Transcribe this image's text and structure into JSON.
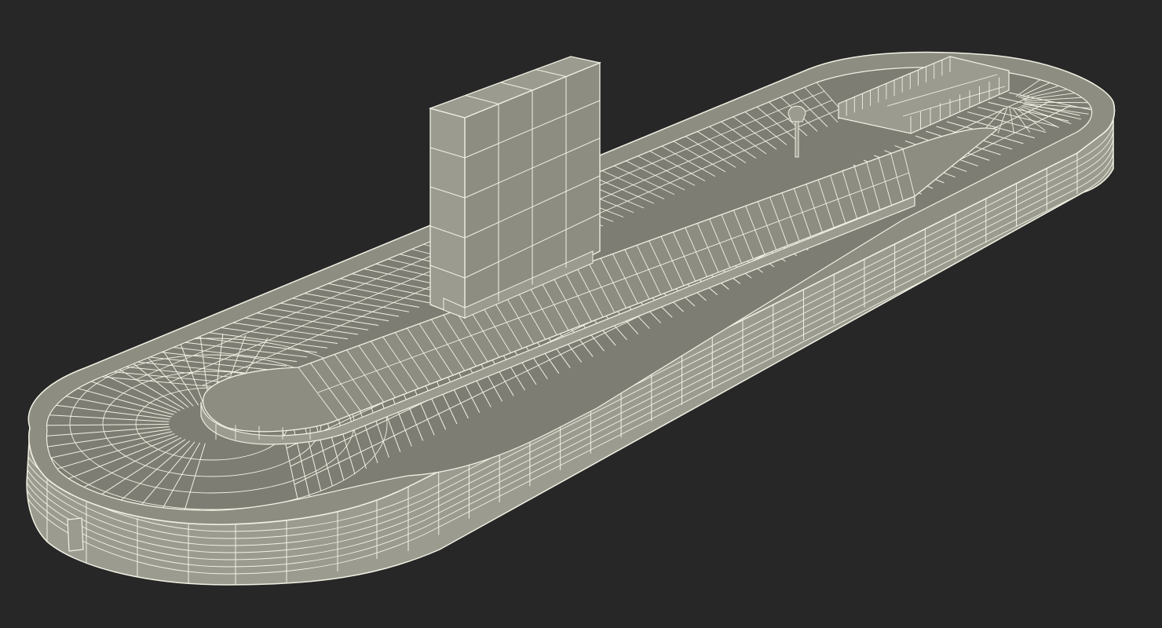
{
  "scene": {
    "subject": "baggage-carousel-wireframe",
    "background_color": "#272727",
    "surface_color": "#8d8d82",
    "surface_shade_color": "#7d7d73",
    "side_color": "#9b9b90",
    "wire_color": "#f2f1e4"
  }
}
